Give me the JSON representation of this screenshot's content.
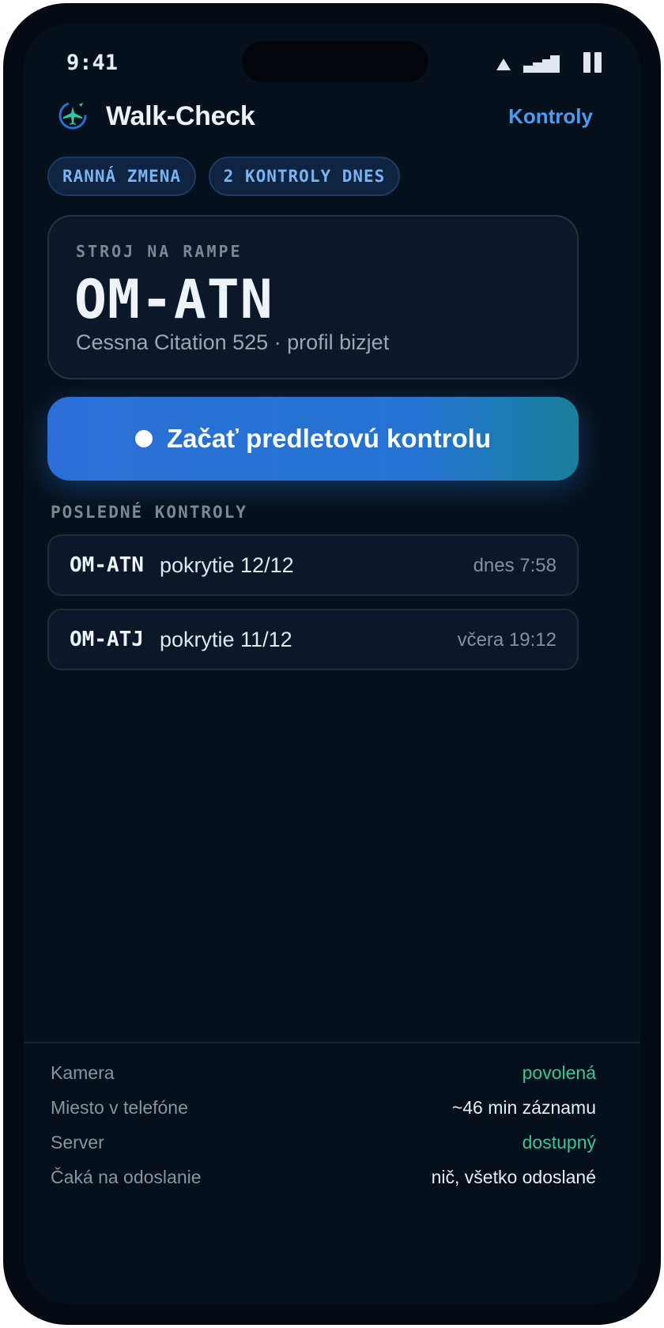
{
  "status_bar": {
    "time": "9:41"
  },
  "header": {
    "app_title": "Walk-Check",
    "link_label": "Kontroly"
  },
  "chips": [
    "RANNÁ ZMENA",
    "2 KONTROLY DNES"
  ],
  "aircraft_card": {
    "kicker": "STROJ NA RAMPE",
    "registration": "OM-ATN",
    "type": "Cessna Citation 525 · profil bizjet"
  },
  "start_button": {
    "label": "Začať predletovú kontrolu"
  },
  "recent": {
    "title": "POSLEDNÉ KONTROLY",
    "items": [
      {
        "registration": "OM-ATN",
        "coverage": "pokrytie 12/12",
        "time": "dnes 7:58"
      },
      {
        "registration": "OM-ATJ",
        "coverage": "pokrytie 11/12",
        "time": "včera 19:12"
      }
    ]
  },
  "footer": {
    "rows": [
      {
        "label": "Kamera",
        "value": "povolená",
        "color": "#2fc99a"
      },
      {
        "label": "Miesto v telefóne",
        "value": "~46 min záznamu",
        "color": "#e6edf5"
      },
      {
        "label": "Server",
        "value": "dostupný",
        "color": "#2fc99a"
      },
      {
        "label": "Čaká na odoslanie",
        "value": "nič, všetko odoslané",
        "color": "#e6edf5"
      }
    ]
  },
  "colors": {
    "accent": "#4d9cf0",
    "success": "#2fc99a",
    "background": "#07111c"
  },
  "icons": [
    "wifi-icon",
    "signal-icon",
    "battery-icon",
    "plane-logo-icon",
    "record-dot-icon"
  ]
}
